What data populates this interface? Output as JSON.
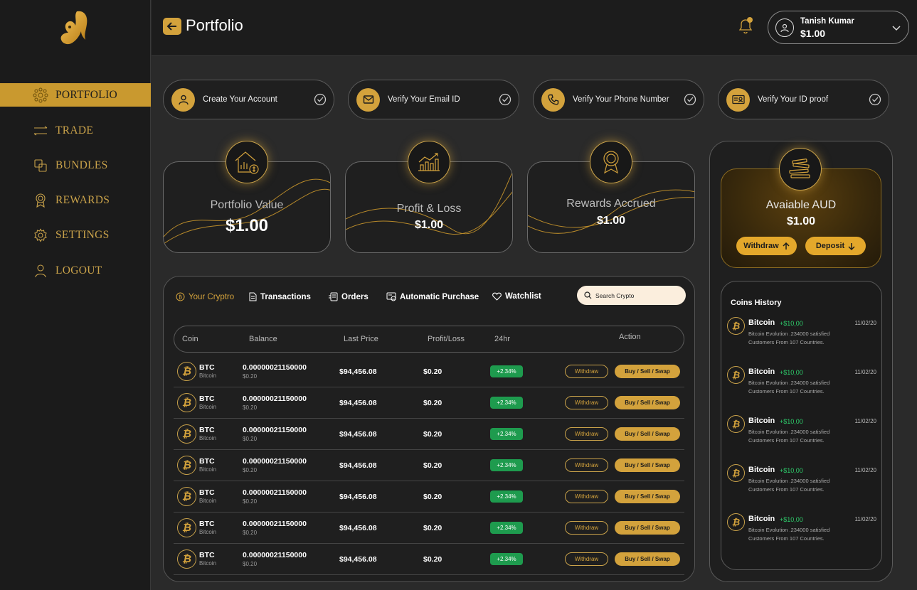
{
  "header": {
    "title": "Portfolio",
    "user_name": "Tanish Kumar",
    "user_balance": "$1.00"
  },
  "sidebar": {
    "items": [
      {
        "label": "PORTFOLIO",
        "icon": "portfolio-icon"
      },
      {
        "label": "TRADE",
        "icon": "trade-icon"
      },
      {
        "label": "BUNDLES",
        "icon": "bundles-icon"
      },
      {
        "label": "REWARDS",
        "icon": "rewards-icon"
      },
      {
        "label": "SETTINGS",
        "icon": "settings-icon"
      },
      {
        "label": "LOGOUT",
        "icon": "logout-icon"
      }
    ]
  },
  "steps": [
    {
      "label": "Create Your Account",
      "icon": "user-icon"
    },
    {
      "label": "Verify Your Email ID",
      "icon": "mail-icon"
    },
    {
      "label": "Verify Your Phone Number",
      "icon": "phone-icon"
    },
    {
      "label": "Verify Your ID proof",
      "icon": "id-card-icon"
    }
  ],
  "stats": [
    {
      "title": "Portfolio Value",
      "value": "$1.00"
    },
    {
      "title": "Profit & Loss",
      "value": "$1.00"
    },
    {
      "title": "Rewards  Accrued",
      "value": "$1.00"
    }
  ],
  "aud": {
    "title": "Avaiable AUD",
    "value": "$1.00",
    "withdraw": "Withdraw",
    "deposit": "Deposit"
  },
  "tabs": [
    "Your Cryptro",
    "Transactions",
    "Orders",
    "Automatic Purchase",
    "Watchlist"
  ],
  "search": {
    "placeholder": "Search Crypto"
  },
  "table": {
    "headers": [
      "Coin",
      "Balance",
      "Last Price",
      "Profit/Loss",
      "24hr",
      "Action"
    ],
    "rows": [
      {
        "symbol": "BTC",
        "name": "Bitcoin",
        "balance": "0.00000021150000",
        "balance_sub": "$0.20",
        "last_price": "$94,456.08",
        "profit_loss": "$0.20",
        "change": "+2.34%",
        "withdraw": "Withdraw",
        "trade": "Buy / Sell / Swap"
      },
      {
        "symbol": "BTC",
        "name": "Bitcoin",
        "balance": "0.00000021150000",
        "balance_sub": "$0.20",
        "last_price": "$94,456.08",
        "profit_loss": "$0.20",
        "change": "+2.34%",
        "withdraw": "Withdraw",
        "trade": "Buy / Sell / Swap"
      },
      {
        "symbol": "BTC",
        "name": "Bitcoin",
        "balance": "0.00000021150000",
        "balance_sub": "$0.20",
        "last_price": "$94,456.08",
        "profit_loss": "$0.20",
        "change": "+2.34%",
        "withdraw": "Withdraw",
        "trade": "Buy / Sell / Swap"
      },
      {
        "symbol": "BTC",
        "name": "Bitcoin",
        "balance": "0.00000021150000",
        "balance_sub": "$0.20",
        "last_price": "$94,456.08",
        "profit_loss": "$0.20",
        "change": "+2.34%",
        "withdraw": "Withdraw",
        "trade": "Buy / Sell / Swap"
      },
      {
        "symbol": "BTC",
        "name": "Bitcoin",
        "balance": "0.00000021150000",
        "balance_sub": "$0.20",
        "last_price": "$94,456.08",
        "profit_loss": "$0.20",
        "change": "+2.34%",
        "withdraw": "Withdraw",
        "trade": "Buy / Sell / Swap"
      },
      {
        "symbol": "BTC",
        "name": "Bitcoin",
        "balance": "0.00000021150000",
        "balance_sub": "$0.20",
        "last_price": "$94,456.08",
        "profit_loss": "$0.20",
        "change": "+2.34%",
        "withdraw": "Withdraw",
        "trade": "Buy / Sell / Swap"
      },
      {
        "symbol": "BTC",
        "name": "Bitcoin",
        "balance": "0.00000021150000",
        "balance_sub": "$0.20",
        "last_price": "$94,456.08",
        "profit_loss": "$0.20",
        "change": "+2.34%",
        "withdraw": "Withdraw",
        "trade": "Buy / Sell / Swap"
      }
    ]
  },
  "history": {
    "title": "Coins History",
    "items": [
      {
        "name": "Bitcoin",
        "change": "+$10,00",
        "date": "11/02/20",
        "desc": "Bitcoin Evolution .234000 satisfied Customers From 107 Countries."
      },
      {
        "name": "Bitcoin",
        "change": "+$10,00",
        "date": "11/02/20",
        "desc": "Bitcoin Evolution .234000 satisfied Customers From 107 Countries."
      },
      {
        "name": "Bitcoin",
        "change": "+$10,00",
        "date": "11/02/20",
        "desc": "Bitcoin Evolution .234000 satisfied Customers From 107 Countries."
      },
      {
        "name": "Bitcoin",
        "change": "+$10,00",
        "date": "11/02/20",
        "desc": "Bitcoin Evolution .234000 satisfied Customers From 107 Countries."
      },
      {
        "name": "Bitcoin",
        "change": "+$10,00",
        "date": "11/02/20",
        "desc": "Bitcoin Evolution .234000 satisfied Customers From 107 Countries."
      }
    ]
  },
  "colors": {
    "accent": "#d3a23c",
    "background": "#2a2a2a",
    "panel": "#1f1f1f",
    "positive": "#1e9b4e"
  }
}
